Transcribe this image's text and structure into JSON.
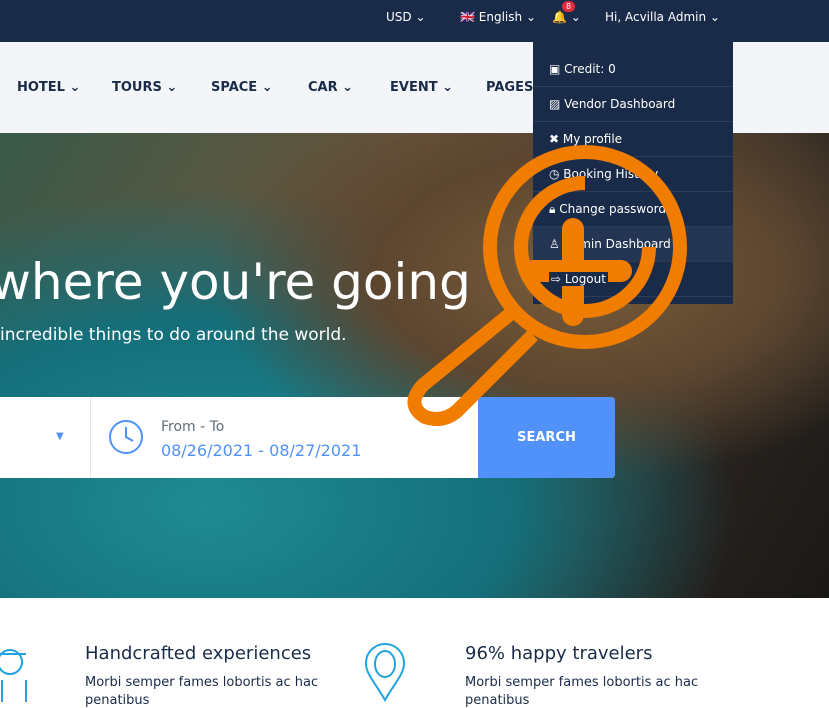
{
  "topbar": {
    "currency": "USD",
    "language": "English",
    "notification_count": "8",
    "greeting": "Hi, Acvilla Admin"
  },
  "nav": [
    "HOTEL",
    "TOURS",
    "SPACE",
    "CAR",
    "EVENT",
    "PAGES"
  ],
  "dropdown": [
    "Credit: 0",
    "Vendor Dashboard",
    "My profile",
    "Booking History",
    "Change password",
    "Admin Dashboard",
    "Logout"
  ],
  "hero": {
    "title": "where you're going",
    "subtitle": "incredible things to do around the world."
  },
  "search": {
    "date_label": "From - To",
    "date_value": "08/26/2021 - 08/27/2021",
    "button": "SEARCH"
  },
  "features": [
    {
      "title": "Handcrafted experiences",
      "text": "Morbi semper fames lobortis ac hac",
      "text2": "penatibus"
    },
    {
      "title": "96% happy travelers",
      "text": "Morbi semper fames lobortis ac hac",
      "text2": "penatibus"
    }
  ],
  "colors": {
    "primary": "#1a2b49",
    "accent": "#5191fa",
    "cursor": "#f07c00"
  }
}
